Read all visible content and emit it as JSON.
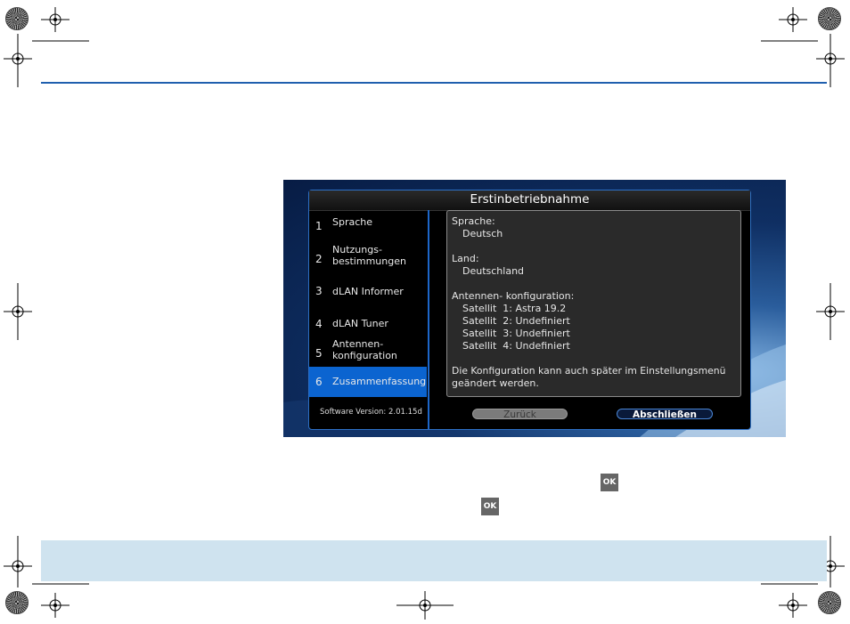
{
  "dialog": {
    "title": "Erstinbetriebnahme",
    "steps": [
      {
        "num": "1",
        "label": "Sprache"
      },
      {
        "num": "2",
        "label": "Nutzungs-\nbestimmungen"
      },
      {
        "num": "3",
        "label": "dLAN Informer"
      },
      {
        "num": "4",
        "label": "dLAN Tuner"
      },
      {
        "num": "5",
        "label": "Antennen-\nkonfiguration"
      },
      {
        "num": "6",
        "label": "Zusammenfassung"
      }
    ],
    "active_step": 6,
    "version": "Software Version: 2.01.15d",
    "summary": {
      "language_label": "Sprache:",
      "language_value": "Deutsch",
      "country_label": "Land:",
      "country_value": "Deutschland",
      "antenna_label": "Antennen- konfiguration:",
      "satellites": [
        "Satellit  1: Astra 19.2",
        "Satellit  2: Undefiniert",
        "Satellit  3: Undefiniert",
        "Satellit  4: Undefiniert"
      ],
      "note_line1": "Die Konfiguration kann auch später im Einstellungsmenü",
      "note_line2": "geändert werden."
    },
    "buttons": {
      "back": "Zurück",
      "finish": "Abschließen"
    }
  },
  "ok_icons": [
    "OK",
    "OK"
  ],
  "colors": {
    "accent": "#1f5fae",
    "active_step": "#0b64d0",
    "band": "#cfe3ef"
  }
}
